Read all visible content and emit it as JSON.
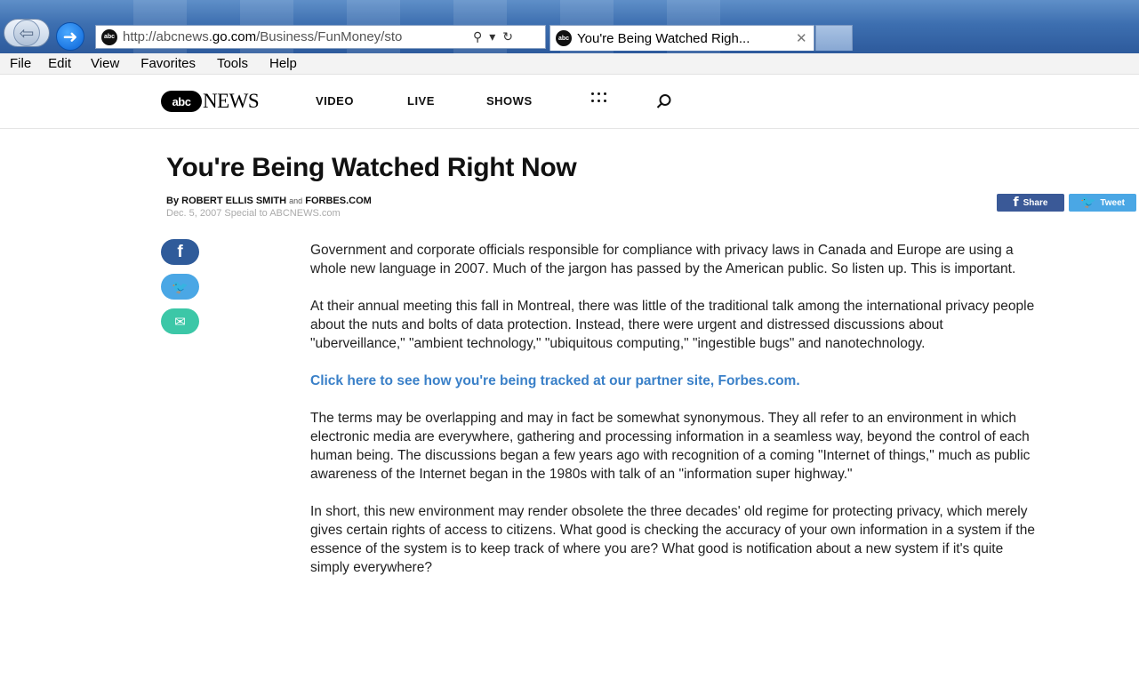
{
  "browser": {
    "url_prefix": "http://abcnews.",
    "url_domain": "go.com",
    "url_suffix": "/Business/FunMoney/sto",
    "tab_title": "You're Being Watched Righ...",
    "favicon_text": "abc",
    "menu": [
      "File",
      "Edit",
      "View",
      "Favorites",
      "Tools",
      "Help"
    ],
    "icons": {
      "back": "back-arrow-icon",
      "forward": "forward-arrow-icon",
      "search": "search-icon",
      "refresh": "refresh-icon",
      "close": "close-icon"
    }
  },
  "site": {
    "logo_abc": "abc",
    "logo_news": "NEWS",
    "nav": [
      "VIDEO",
      "LIVE",
      "SHOWS"
    ]
  },
  "article": {
    "headline": "You're Being Watched Right Now",
    "byline_prefix": "By ",
    "author": "ROBERT ELLIS SMITH",
    "and": "and",
    "source": "FORBES.COM",
    "dateline": "Dec. 5, 2007 Special to ABCNEWS.com",
    "share_label": "Share",
    "tweet_label": "Tweet",
    "paragraphs": [
      "Government and corporate officials responsible for compliance with privacy laws in Canada and Europe are using a whole new language in 2007. Much of the jargon has passed by the American public. So listen up. This is important.",
      "At their annual meeting this fall in Montreal, there was little of the traditional talk among the international privacy people about the nuts and bolts of data protection. Instead, there were urgent and distressed discussions about \"uberveillance,\" \"ambient technology,\" \"ubiquitous computing,\" \"ingestible bugs\" and nanotechnology."
    ],
    "link_text": "Click here to see how you're being tracked at our partner site, Forbes.com.",
    "paragraphs_after": [
      "The terms may be overlapping and may in fact be somewhat synonymous. They all refer to an environment in which electronic media are everywhere, gathering and processing information in a seamless way, beyond the control of each human being. The discussions began a few years ago with recognition of a coming \"Internet of things,\" much as public awareness of the Internet began in the 1980s with talk of an \"information super highway.\"",
      "In short, this new environment may render obsolete the three decades' old regime for protecting privacy, which merely gives certain rights of access to citizens. What good is checking the accuracy of your own information in a system if the essence of the system is to keep track of where you are? What good is notification about a new system if it's quite simply everywhere?"
    ]
  }
}
